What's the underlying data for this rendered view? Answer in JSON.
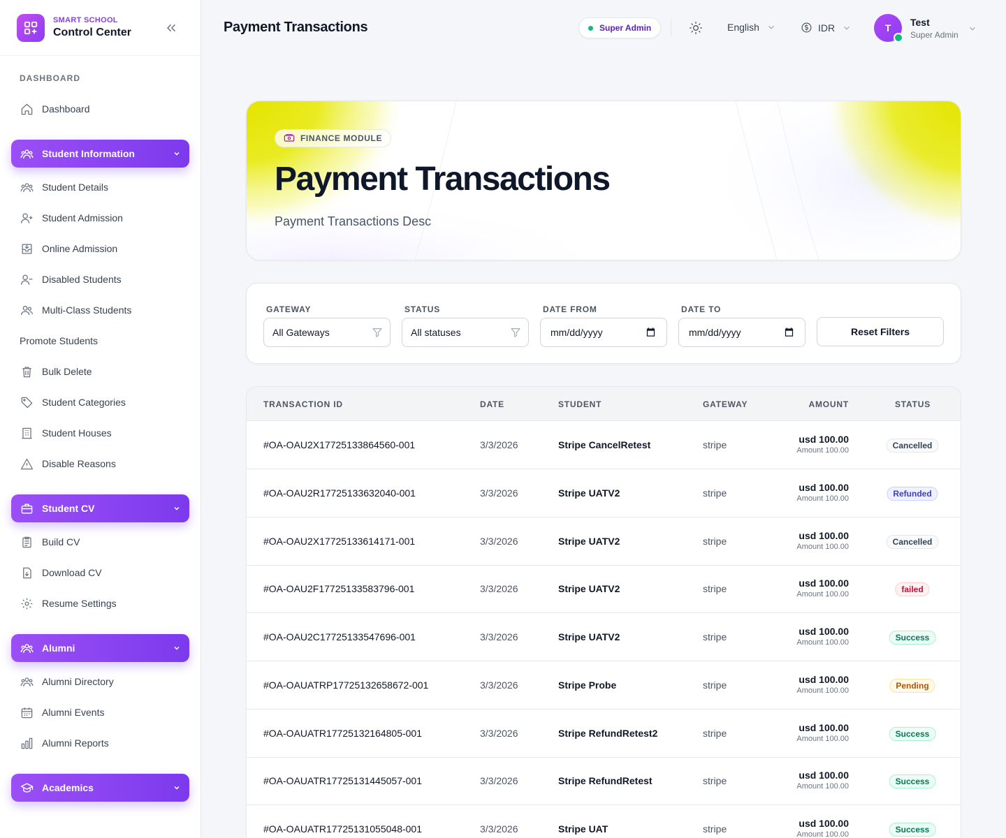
{
  "brand": {
    "subtitle": "SMART SCHOOL",
    "title": "Control Center"
  },
  "sidebar": {
    "section_label": "DASHBOARD",
    "dashboard": "Dashboard",
    "groups": {
      "student_information": "Student Information",
      "student_cv": "Student CV",
      "alumni": "Alumni",
      "academics": "Academics"
    },
    "student_information_items": [
      "Student Details",
      "Student Admission",
      "Online Admission",
      "Disabled Students",
      "Multi-Class Students",
      "Promote Students",
      "Bulk Delete",
      "Student Categories",
      "Student Houses",
      "Disable Reasons"
    ],
    "student_cv_items": [
      "Build CV",
      "Download CV",
      "Resume Settings"
    ],
    "alumni_items": [
      "Alumni Directory",
      "Alumni Events",
      "Alumni Reports"
    ]
  },
  "header": {
    "title": "Payment Transactions",
    "role_badge": "Super Admin",
    "language": "English",
    "currency": "IDR",
    "user": {
      "initial": "T",
      "name": "Test",
      "role": "Super Admin"
    }
  },
  "hero": {
    "badge": "FINANCE MODULE",
    "title": "Payment Transactions",
    "description": "Payment Transactions Desc"
  },
  "filters": {
    "gateway": {
      "label": "GATEWAY",
      "value": "All Gateways"
    },
    "status": {
      "label": "STATUS",
      "value": "All statuses"
    },
    "date_from": {
      "label": "DATE FROM",
      "placeholder": "mm/dd/yyyy"
    },
    "date_to": {
      "label": "DATE TO",
      "placeholder": "mm/dd/yyyy"
    },
    "reset_label": "Reset Filters"
  },
  "table": {
    "columns": {
      "transaction_id": "TRANSACTION ID",
      "date": "DATE",
      "student": "STUDENT",
      "gateway": "GATEWAY",
      "amount": "AMOUNT",
      "status": "STATUS"
    },
    "rows": [
      {
        "id": "#OA-OAU2X17725133864560-001",
        "date": "3/3/2026",
        "student": "Stripe CancelRetest",
        "gateway": "stripe",
        "amount": "usd 100.00",
        "amount_sub": "Amount 100.00",
        "status": "Cancelled"
      },
      {
        "id": "#OA-OAU2R17725133632040-001",
        "date": "3/3/2026",
        "student": "Stripe UATV2",
        "gateway": "stripe",
        "amount": "usd 100.00",
        "amount_sub": "Amount 100.00",
        "status": "Refunded"
      },
      {
        "id": "#OA-OAU2X17725133614171-001",
        "date": "3/3/2026",
        "student": "Stripe UATV2",
        "gateway": "stripe",
        "amount": "usd 100.00",
        "amount_sub": "Amount 100.00",
        "status": "Cancelled"
      },
      {
        "id": "#OA-OAU2F17725133583796-001",
        "date": "3/3/2026",
        "student": "Stripe UATV2",
        "gateway": "stripe",
        "amount": "usd 100.00",
        "amount_sub": "Amount 100.00",
        "status": "failed"
      },
      {
        "id": "#OA-OAU2C17725133547696-001",
        "date": "3/3/2026",
        "student": "Stripe UATV2",
        "gateway": "stripe",
        "amount": "usd 100.00",
        "amount_sub": "Amount 100.00",
        "status": "Success"
      },
      {
        "id": "#OA-OAUATRP17725132658672-001",
        "date": "3/3/2026",
        "student": "Stripe Probe",
        "gateway": "stripe",
        "amount": "usd 100.00",
        "amount_sub": "Amount 100.00",
        "status": "Pending"
      },
      {
        "id": "#OA-OAUATR17725132164805-001",
        "date": "3/3/2026",
        "student": "Stripe RefundRetest2",
        "gateway": "stripe",
        "amount": "usd 100.00",
        "amount_sub": "Amount 100.00",
        "status": "Success"
      },
      {
        "id": "#OA-OAUATR17725131445057-001",
        "date": "3/3/2026",
        "student": "Stripe RefundRetest",
        "gateway": "stripe",
        "amount": "usd 100.00",
        "amount_sub": "Amount 100.00",
        "status": "Success"
      },
      {
        "id": "#OA-OAUATR17725131055048-001",
        "date": "3/3/2026",
        "student": "Stripe UAT",
        "gateway": "stripe",
        "amount": "usd 100.00",
        "amount_sub": "Amount 100.00",
        "status": "Success"
      }
    ]
  },
  "colors": {
    "accent": "#7c3aed",
    "status": {
      "Cancelled": {
        "bg": "#f9fafb",
        "fg": "#374151",
        "border": "#e5e7eb"
      },
      "Refunded": {
        "bg": "#eef2ff",
        "fg": "#4338ca",
        "border": "#c7d2fe"
      },
      "failed": {
        "bg": "#fef2f2",
        "fg": "#be123c",
        "border": "#fecdd3"
      },
      "Success": {
        "bg": "#ecfdf5",
        "fg": "#047857",
        "border": "#a7f3d0"
      },
      "Pending": {
        "bg": "#fffbeb",
        "fg": "#b45309",
        "border": "#fde68a"
      }
    }
  }
}
